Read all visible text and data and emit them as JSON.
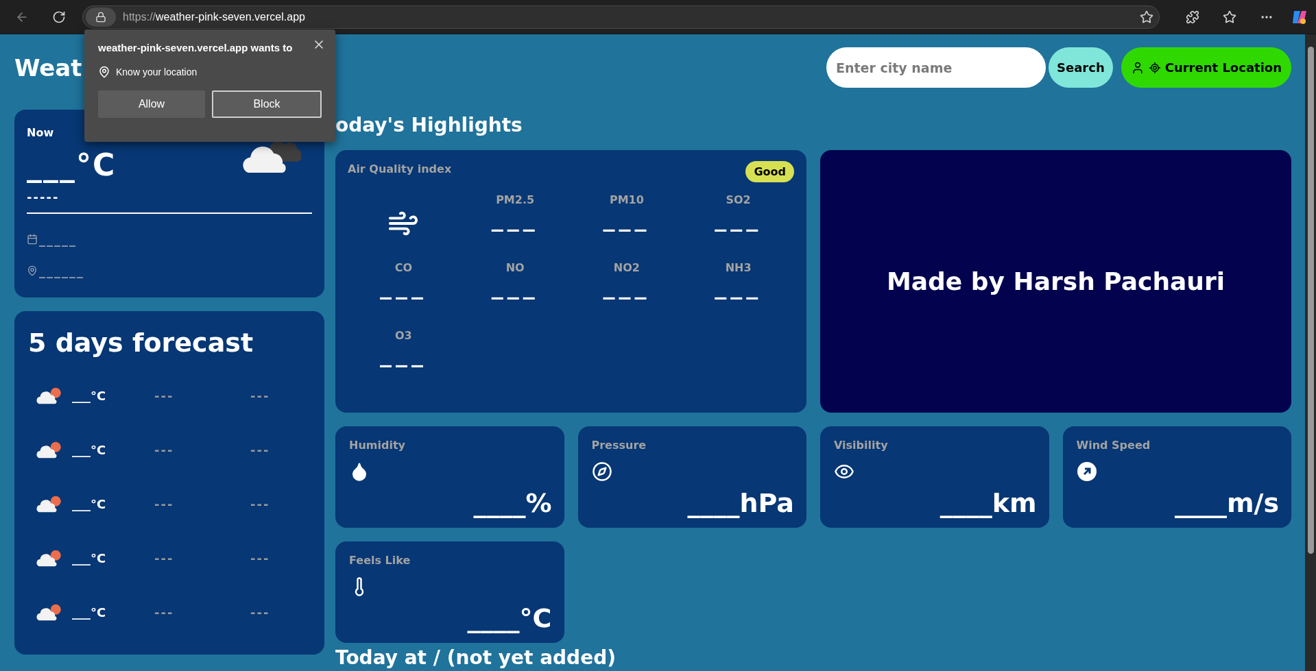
{
  "browser": {
    "scheme": "https://",
    "host": "weather-pink-seven.vercel.app"
  },
  "permission_popup": {
    "title": "weather-pink-seven.vercel.app wants to",
    "permission": "Know your location",
    "buttons": [
      "Allow",
      "Block"
    ]
  },
  "header": {
    "title": "Weat",
    "search": {
      "placeholder": "Enter city name"
    },
    "search_button": "Search",
    "location_button": "Current Location"
  },
  "now": {
    "label": "Now",
    "temperature": "___°C",
    "description": "-----",
    "date": "_____",
    "location": "______"
  },
  "forecast": {
    "title": "5 days forecast",
    "rows": [
      {
        "temperature": "___°C",
        "column_2": "---",
        "column_3": "---"
      },
      {
        "temperature": "___°C",
        "column_2": "---",
        "column_3": "---"
      },
      {
        "temperature": "___°C",
        "column_2": "---",
        "column_3": "---"
      },
      {
        "temperature": "___°C",
        "column_2": "---",
        "column_3": "---"
      },
      {
        "temperature": "___°C",
        "column_2": "---",
        "column_3": "---"
      }
    ]
  },
  "highlights": {
    "title": "oday's Highlights",
    "air_quality": {
      "title": "Air Quality index",
      "badge": "Good",
      "items": [
        {
          "label": "PM2.5",
          "value": "___"
        },
        {
          "label": "PM10",
          "value": "___"
        },
        {
          "label": "SO2",
          "value": "___"
        },
        {
          "label": "CO",
          "value": "___"
        },
        {
          "label": "NO",
          "value": "___"
        },
        {
          "label": "NO2",
          "value": "___"
        },
        {
          "label": "NH3",
          "value": "___"
        },
        {
          "label": "O3",
          "value": "___"
        }
      ]
    },
    "credit": "Made by Harsh Pachauri",
    "stats": [
      {
        "kind": "humidity",
        "label": "Humidity",
        "value": "____%"
      },
      {
        "kind": "pressure",
        "label": "Pressure",
        "value": "____hPa"
      },
      {
        "kind": "visibility",
        "label": "Visibility",
        "value": "____km"
      },
      {
        "kind": "wind",
        "label": "Wind Speed",
        "value": "____m/s"
      },
      {
        "kind": "feels",
        "label": "Feels Like",
        "value": "____°C"
      }
    ]
  },
  "today_title": "Today at / (not yet added)"
}
